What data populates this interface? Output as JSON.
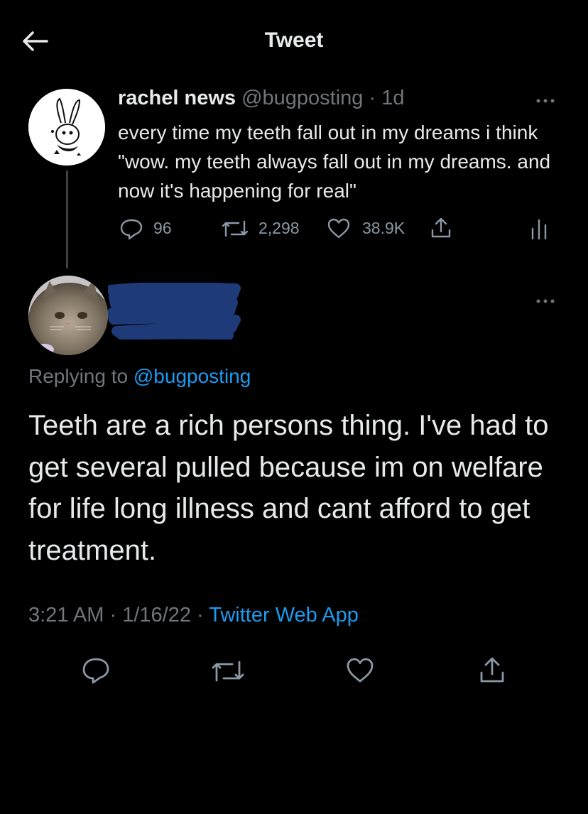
{
  "header": {
    "title": "Tweet",
    "back_icon": "arrow-left-icon"
  },
  "original_tweet": {
    "display_name": "rachel news",
    "handle": "@bugposting",
    "separator": "·",
    "age": "1d",
    "text": "every time my teeth fall out in my dreams i think \"wow. my teeth always fall out in my dreams. and now it's happening for real\"",
    "stats": {
      "replies": "96",
      "retweets": "2,298",
      "likes": "38.9K"
    }
  },
  "reply_tweet": {
    "replying_prefix": "Replying to",
    "replying_handle": "@bugposting",
    "text": "Teeth are a rich persons thing. I've had to get several pulled because im on welfare for life long illness and cant afford to get treatment.",
    "time": "3:21 AM",
    "sep1": "·",
    "date": "1/16/22",
    "sep2": "·",
    "source": "Twitter Web App"
  },
  "colors": {
    "background": "#000000",
    "text": "#e7e9ea",
    "muted": "#71767b",
    "accent": "#1d9bf0",
    "redaction": "#1f3a78"
  }
}
